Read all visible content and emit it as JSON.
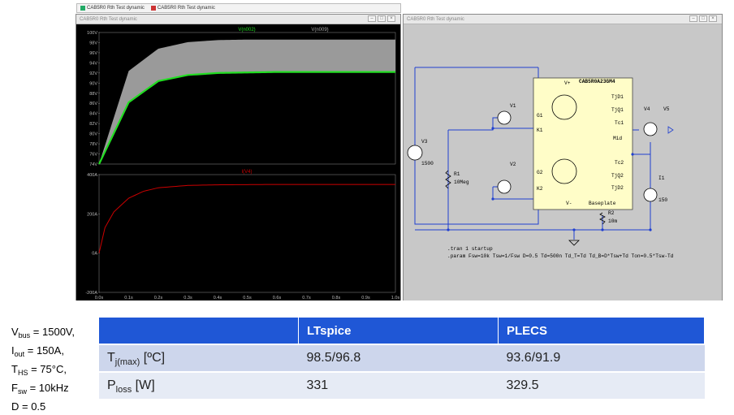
{
  "tabs": [
    "CAB5R0 Rth Test dynamic",
    "CAB5R0 Rth Test dynamic"
  ],
  "waveform_window": {
    "title": "CAB5R0 Rth Test dynamic",
    "top_plot": {
      "trace_labels": [
        "V(n002)",
        "V(n009)"
      ],
      "trace_colors": [
        "#22dd22",
        "#9a9a9a"
      ],
      "y_ticks": [
        "100V",
        "98V",
        "96V",
        "94V",
        "92V",
        "90V",
        "88V",
        "86V",
        "84V",
        "82V",
        "80V",
        "78V",
        "76V",
        "74V"
      ]
    },
    "bottom_plot": {
      "trace_label": "I(V4)",
      "trace_color": "#cc0000",
      "y_ticks": [
        "400A",
        "200A",
        "0A",
        "-200A"
      ]
    },
    "x_ticks": [
      "0.0s",
      "0.1s",
      "0.2s",
      "0.3s",
      "0.4s",
      "0.5s",
      "0.6s",
      "0.7s",
      "0.8s",
      "0.9s",
      "1.0s"
    ]
  },
  "chart_data": [
    {
      "type": "area",
      "series": [
        {
          "name": "V(n002)",
          "x": [
            0,
            0.1,
            0.2,
            0.3,
            0.4,
            0.5,
            0.6,
            0.7,
            0.8,
            0.9,
            1.0
          ],
          "y": [
            74,
            86.2,
            90.4,
            91.6,
            92.0,
            92.1,
            92.2,
            92.2,
            92.2,
            92.2,
            92.2
          ]
        },
        {
          "name": "V(n009)",
          "x": [
            0,
            0.1,
            0.2,
            0.3,
            0.4,
            0.5,
            0.6,
            0.7,
            0.8,
            0.9,
            1.0
          ],
          "y": [
            74,
            92.4,
            96.8,
            98.1,
            98.5,
            98.6,
            98.6,
            98.6,
            98.6,
            98.6,
            98.6
          ]
        }
      ],
      "ylim": [
        74,
        100
      ],
      "xlim": [
        0,
        1.0
      ]
    },
    {
      "type": "line",
      "series": [
        {
          "name": "I(V4)",
          "x": [
            0,
            0.02,
            0.05,
            0.1,
            0.15,
            0.2,
            0.3,
            0.4,
            0.5,
            0.6,
            1.0
          ],
          "y": [
            0,
            130,
            210,
            280,
            315,
            333,
            345,
            348,
            349,
            350,
            350
          ]
        }
      ],
      "ylim": [
        -200,
        400
      ],
      "xlim": [
        0,
        1.0
      ]
    }
  ],
  "schematic_window": {
    "title": "CAB5R0 Rth Test dynamic",
    "module_name": "CAB5R0A23GM4",
    "pins": {
      "vplus": "V+",
      "vminus": "V-",
      "g1": "G1",
      "k1": "K1",
      "g2": "G2",
      "k2": "K2",
      "tjd1": "TjD1",
      "tjq1": "TjQ1",
      "tc1": "Tc1",
      "mid": "Mid",
      "tc2": "Tc2",
      "tjq2": "TjQ2",
      "tjd2": "TjD2",
      "baseplate": "Baseplate"
    },
    "components": {
      "v3": "V3",
      "v3_value": "1500",
      "r1": "R1",
      "r1_value": "10Meg",
      "v1": "V1",
      "v2": "V2",
      "v4": "V4",
      "v5": "V5",
      "r2": "R2",
      "r2_value": "10m",
      "i1": "I1",
      "i1_value": "150"
    },
    "directives": [
      ".tran 1 startup",
      ".param Fsw=10k Tsw=1/Fsw D=0.5 Td=500n Td_T=Td Td_B=D*Tsw+Td Ton=0.5*Tsw-Td"
    ]
  },
  "params": {
    "vbus": {
      "base": "V",
      "sub": "bus",
      "val": " = 1500V,"
    },
    "iout": {
      "base": "I",
      "sub": "out",
      "val": " = 150A,"
    },
    "ths": {
      "base": "T",
      "sub": "HS",
      "val": " = 75°C,"
    },
    "fsw": {
      "base": "F",
      "sub": "sw",
      "val": " = 10kHz"
    },
    "d": "D = 0.5"
  },
  "results_table": {
    "headers": [
      "",
      "LTspice",
      "PLECS"
    ],
    "rows": [
      {
        "label_base": "T",
        "label_sub": "j(max)",
        "label_unit": " [ºC]",
        "ltspice": "98.5/96.8",
        "plecs": "93.6/91.9"
      },
      {
        "label_base": "P",
        "label_sub": "loss",
        "label_unit": " [W]",
        "ltspice": "331",
        "plecs": "329.5"
      }
    ]
  }
}
